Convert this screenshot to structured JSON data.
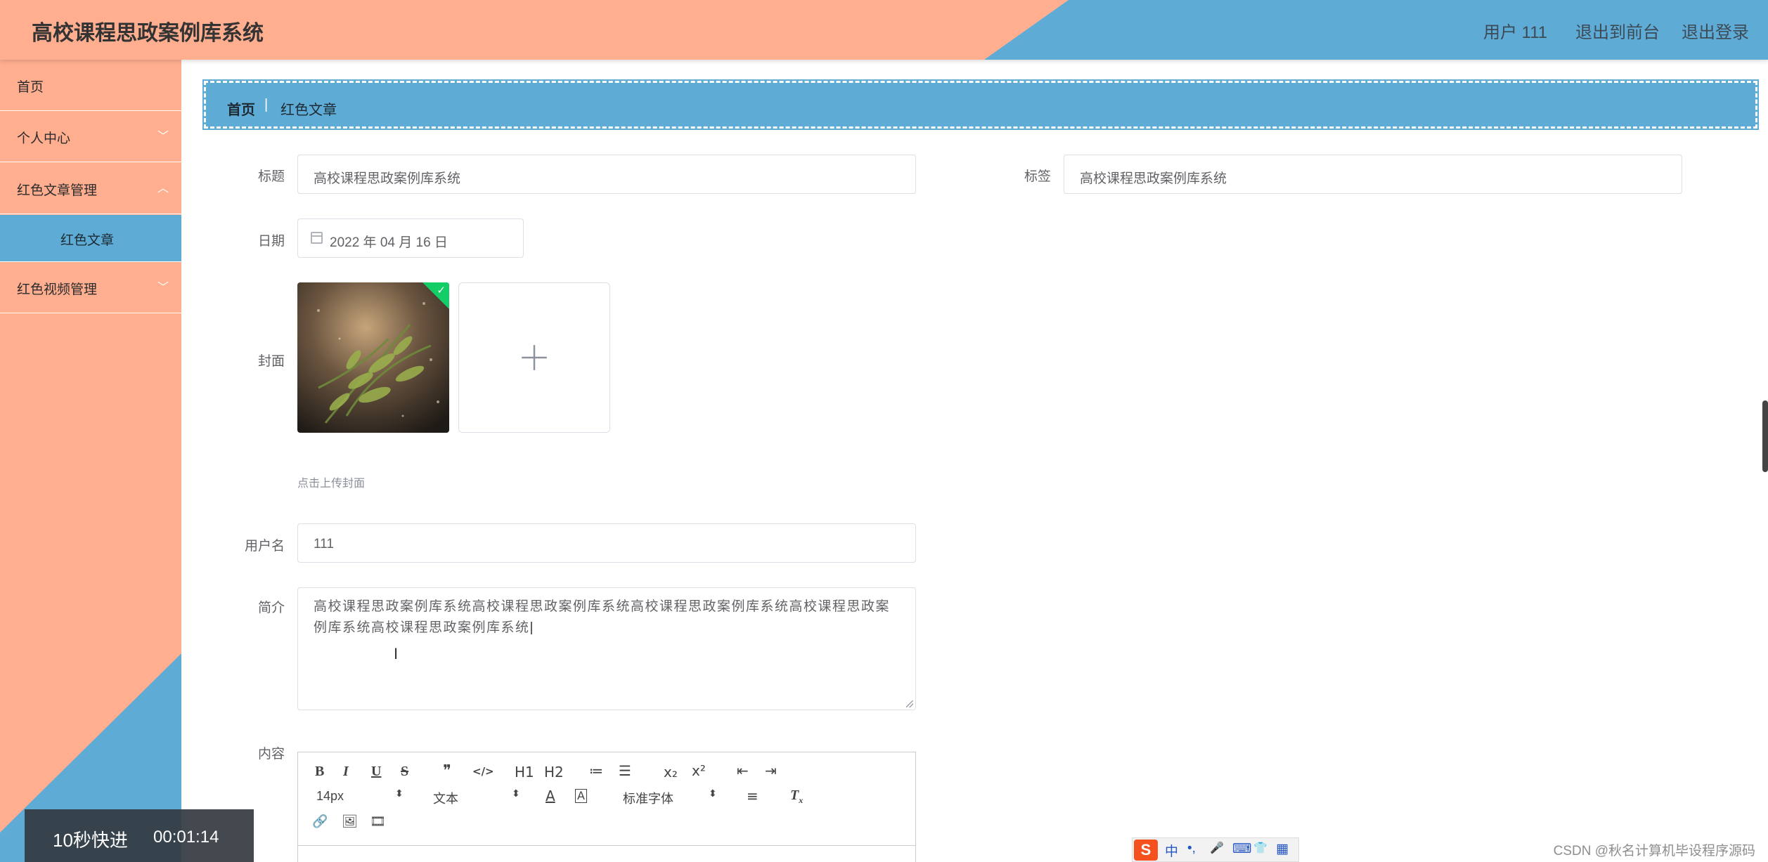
{
  "app": {
    "title": "高校课程思政案例库系统"
  },
  "header": {
    "user_label": "用户 111",
    "front_link": "退出到前台",
    "logout_link": "退出登录"
  },
  "sidebar": {
    "items": [
      {
        "label": "首页"
      },
      {
        "label": "个人中心"
      },
      {
        "label": "红色文章管理"
      },
      {
        "label": "红色文章"
      },
      {
        "label": "红色视频管理"
      }
    ]
  },
  "breadcrumb": {
    "home": "首页",
    "separator": "|",
    "current": "红色文章"
  },
  "form": {
    "title_label": "标题",
    "title_value": "高校课程思政案例库系统",
    "tag_label": "标签",
    "tag_value": "高校课程思政案例库系统",
    "date_label": "日期",
    "date_value": "2022 年 04 月 16 日",
    "cover_label": "封面",
    "cover_hint": "点击上传封面",
    "username_label": "用户名",
    "username_value": "111",
    "intro_label": "简介",
    "intro_value": "高校课程思政案例库系统高校课程思政案例库系统高校课程思政案例库系统高校课程思政案例库系统高校课程思政案例库系统",
    "content_label": "内容"
  },
  "editor": {
    "toolbar_row1": [
      "B",
      "I",
      "U",
      "S",
      "❞",
      "</>",
      "H1",
      "H2",
      "≔",
      "☰",
      "x₂",
      "x²",
      "⇤",
      "⇥"
    ],
    "font_size": "14px",
    "paragraph": "文本",
    "font_family": "标准字体"
  },
  "overlay": {
    "speed_text": "10秒快进",
    "time": "00:01:14"
  },
  "ime": {
    "chars": [
      "中",
      "•,",
      "🎤",
      "⌨",
      "👕",
      "▦"
    ]
  },
  "watermark": "CSDN @秋名计算机毕设程序源码",
  "icons": {
    "upload": "plus-icon",
    "calendar": "calendar-icon",
    "check": "check-icon",
    "chevron": "chevron-down-icon"
  }
}
